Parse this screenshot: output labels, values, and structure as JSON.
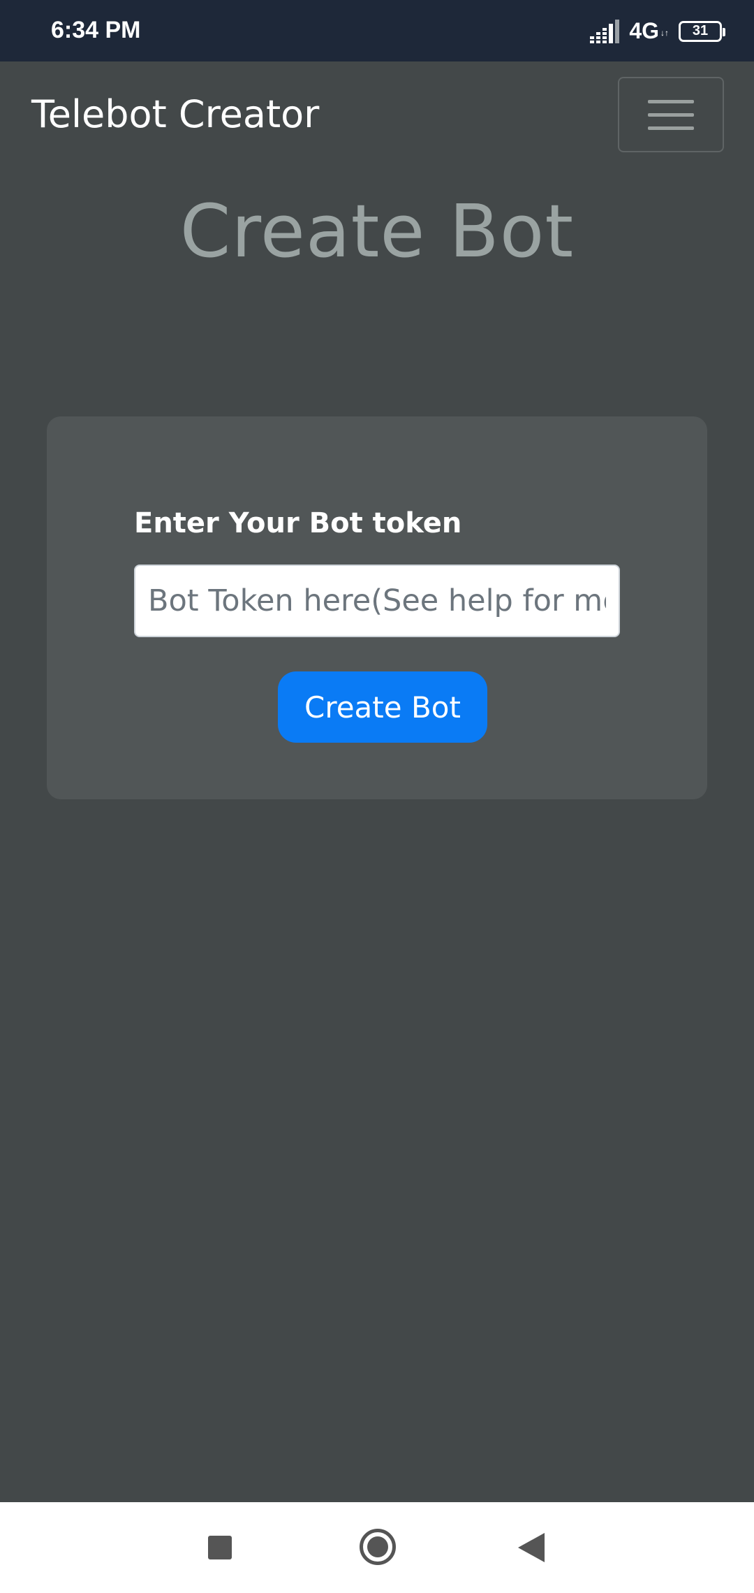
{
  "status_bar": {
    "time": "6:34 PM",
    "network": "4G",
    "network_sub": "↓↑",
    "battery": "31"
  },
  "navbar": {
    "brand": "Telebot Creator",
    "menu_icon": "hamburger-menu-icon"
  },
  "page": {
    "title": "Create Bot"
  },
  "form": {
    "label": "Enter Your Bot token",
    "input_placeholder": "Bot Token here(See help for more info)",
    "input_value": "",
    "submit_label": "Create Bot",
    "submit_color": "#0a7bf5"
  },
  "system_nav": {
    "recent_icon": "square-recent-apps-icon",
    "home_icon": "circle-home-icon",
    "back_icon": "triangle-back-icon"
  }
}
